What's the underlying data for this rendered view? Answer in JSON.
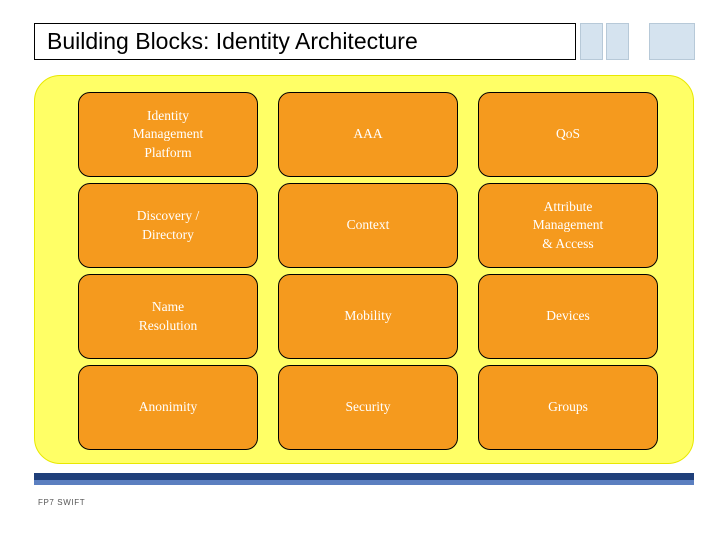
{
  "slide": {
    "title": "Building Blocks: Identity Architecture",
    "footer": "FP7 SWIFT",
    "colors": {
      "panel_background": "#ffff66",
      "block_fill": "#f59a1e",
      "block_text": "#ffffff",
      "bar_dark": "#1f3f7a",
      "bar_light": "#5b7fc0",
      "decoration": "#d5e3ef"
    }
  },
  "blocks": [
    {
      "label": "Identity\nManagement\nPlatform"
    },
    {
      "label": "AAA"
    },
    {
      "label": "QoS"
    },
    {
      "label": "Discovery /\nDirectory"
    },
    {
      "label": "Context"
    },
    {
      "label": "Attribute\nManagement\n& Access"
    },
    {
      "label": "Name\nResolution"
    },
    {
      "label": "Mobility"
    },
    {
      "label": "Devices"
    },
    {
      "label": "Anonimity"
    },
    {
      "label": "Security"
    },
    {
      "label": "Groups"
    }
  ]
}
